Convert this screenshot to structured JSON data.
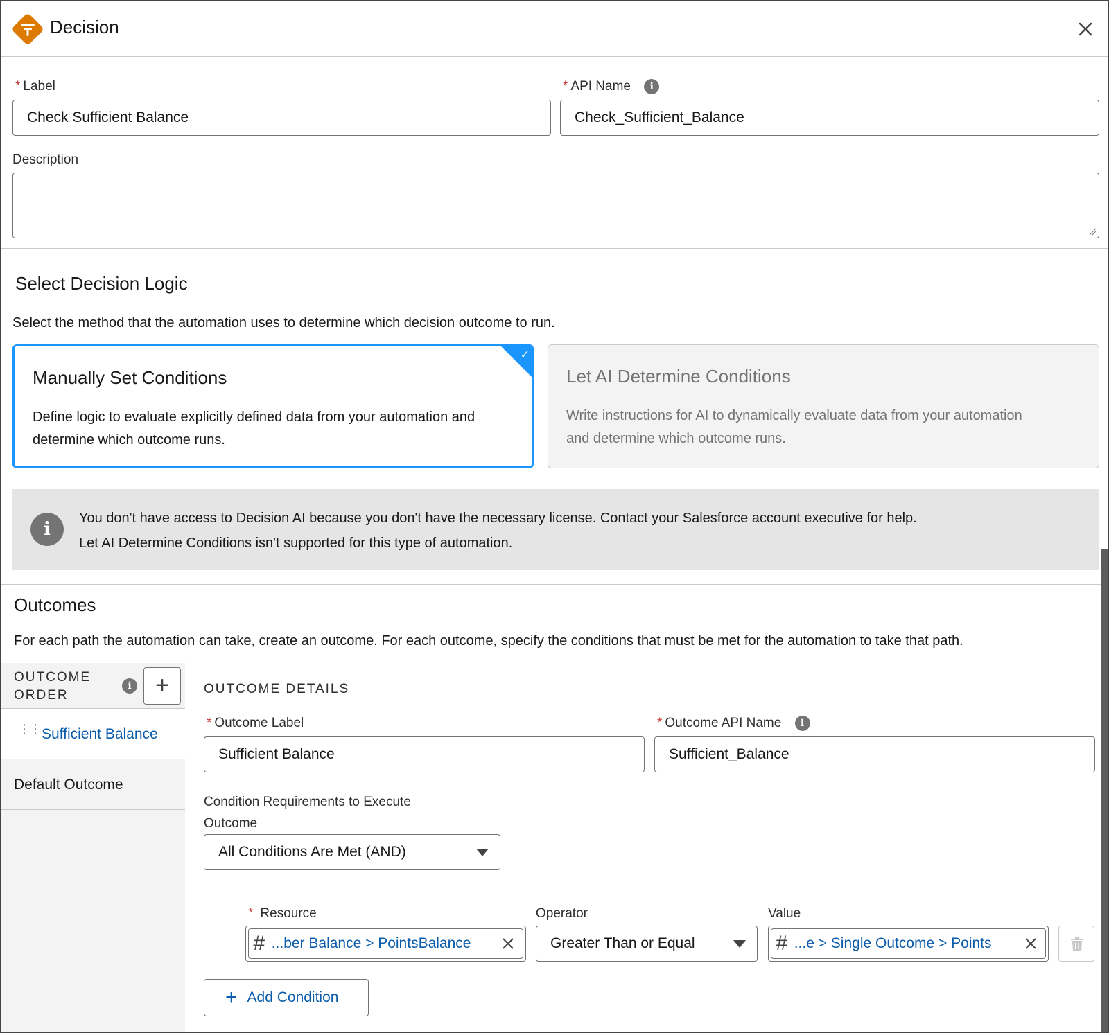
{
  "header": {
    "title": "Decision",
    "icon": "decision-diamond-icon",
    "accent_color": "#dd7a01"
  },
  "fields": {
    "label": {
      "label": "Label",
      "value": "Check Sufficient Balance"
    },
    "api_name": {
      "label": "API Name",
      "value": "Check_Sufficient_Balance"
    },
    "description": {
      "label": "Description",
      "value": ""
    }
  },
  "logic": {
    "title": "Select Decision Logic",
    "subtitle": "Select the method that the automation uses to determine which decision outcome to run.",
    "options": [
      {
        "title": "Manually Set Conditions",
        "desc": "Define logic to evaluate explicitly defined data from your automation and determine which outcome runs.",
        "selected": true
      },
      {
        "title": "Let AI Determine Conditions",
        "desc": "Write instructions for AI to dynamically evaluate data from your automation and determine which outcome runs.",
        "selected": false
      }
    ],
    "notice_line1": "You don't have access to Decision AI because you don't have the necessary license. Contact your Salesforce account executive for help.",
    "notice_line2": "Let AI Determine Conditions isn't supported for this type of automation."
  },
  "outcomes": {
    "title": "Outcomes",
    "subtitle": "For each path the automation can take, create an outcome. For each outcome, specify the conditions that must be met for the automation to take that path.",
    "order_label_1": "OUTCOME",
    "order_label_2": "ORDER",
    "items": [
      {
        "label": "Sufficient Balance",
        "active": true
      },
      {
        "label": "Default Outcome",
        "active": false
      }
    ],
    "details_title": "OUTCOME DETAILS",
    "outcome_label": {
      "label": "Outcome Label",
      "value": "Sufficient Balance"
    },
    "outcome_api_name": {
      "label": "Outcome API Name",
      "value": "Sufficient_Balance"
    },
    "requirements_label_1": "Condition Requirements to Execute",
    "requirements_label_2": "Outcome",
    "requirements_value": "All Conditions Are Met (AND)",
    "condition": {
      "resource_label": "Resource",
      "resource_value": "...ber Balance > PointsBalance",
      "operator_label": "Operator",
      "operator_value": "Greater Than or Equal",
      "value_label": "Value",
      "value_value": "...e > Single Outcome > Points"
    },
    "add_condition_label": "Add Condition"
  }
}
